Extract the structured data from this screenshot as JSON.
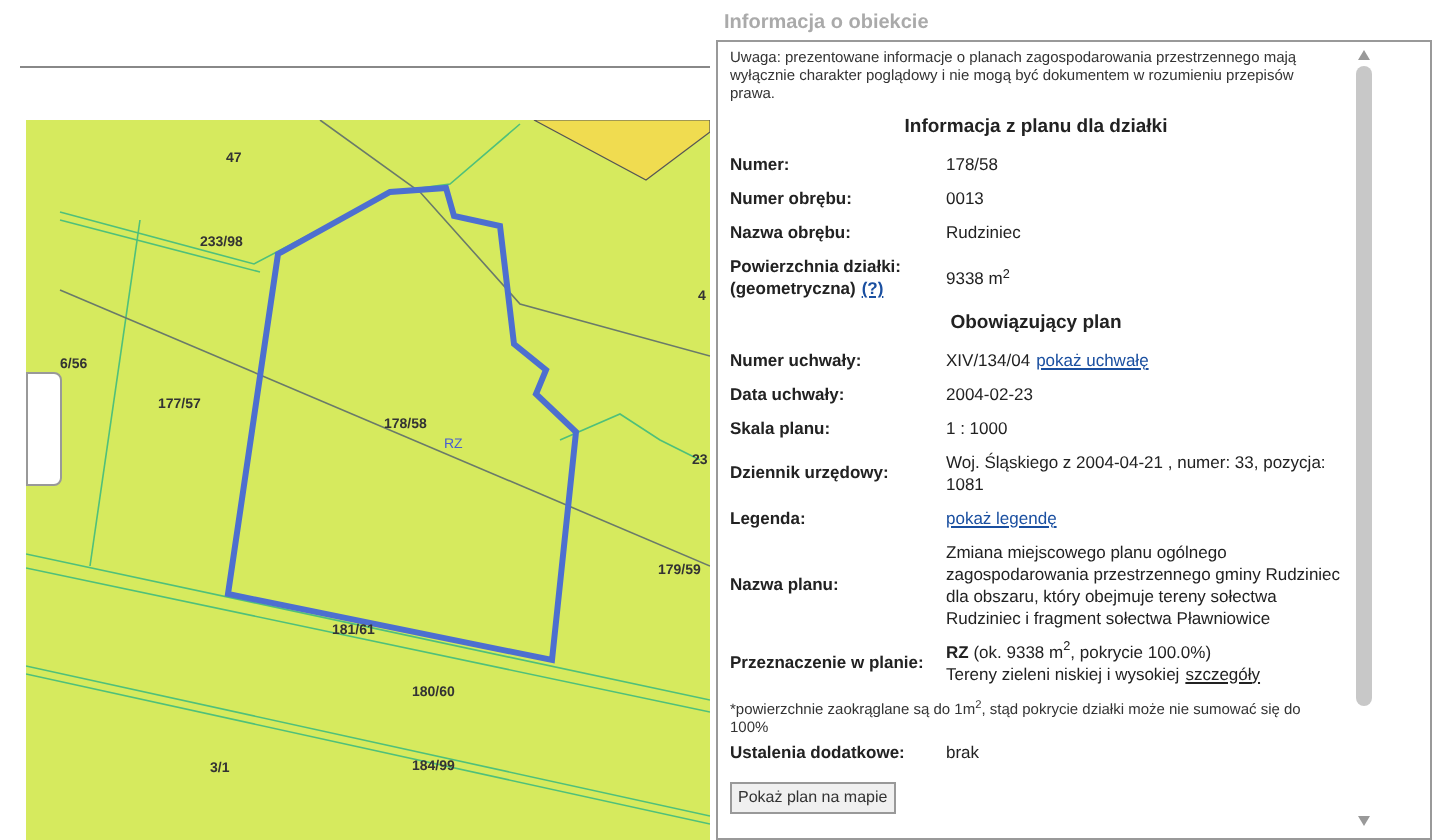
{
  "map": {
    "labels": [
      {
        "text": "47",
        "kind": "parcel"
      },
      {
        "text": "233/98",
        "kind": "parcel"
      },
      {
        "text": "6/56",
        "kind": "parcel"
      },
      {
        "text": "177/57",
        "kind": "parcel"
      },
      {
        "text": "178/58",
        "kind": "parcel"
      },
      {
        "text": "RZ",
        "kind": "zone"
      },
      {
        "text": "179/59",
        "kind": "parcel"
      },
      {
        "text": "181/61",
        "kind": "parcel"
      },
      {
        "text": "180/60",
        "kind": "parcel"
      },
      {
        "text": "3/1",
        "kind": "parcel"
      },
      {
        "text": "184/99",
        "kind": "parcel"
      },
      {
        "text": "4",
        "kind": "parcel"
      },
      {
        "text": "23",
        "kind": "parcel"
      }
    ]
  },
  "panel": {
    "title": "Informacja o obiekcie",
    "notice": "Uwaga: prezentowane informacje o planach zagospodarowania przestrzennego mają wyłącznie charakter poglądowy i nie mogą być dokumentem w rozumieniu przepisów prawa.",
    "heading": "Informacja z planu dla działki",
    "rows": [
      {
        "label": "Numer:",
        "value": "178/58"
      },
      {
        "label": "Numer obrębu:",
        "value": "0013"
      },
      {
        "label": "Nazwa obrębu:",
        "value": "Rudziniec"
      },
      {
        "label": "Powierzchnia działki:",
        "label2": "(geometryczna)",
        "label_link": "(?)",
        "value": "9338 m$^{2}$"
      }
    ],
    "plan_heading": "Obowiązujący plan",
    "plan_rows": [
      {
        "label": "Numer uchwały:",
        "value": "XIV/134/04",
        "link": "pokaż uchwałę"
      },
      {
        "label": "Data uchwały:",
        "value": "2004-02-23"
      },
      {
        "label": "Skala planu:",
        "value": "1 : 1000"
      },
      {
        "label": "Dziennik urzędowy:",
        "value": "Woj. Śląskiego z 2004-04-21 , numer: 33, pozycja: 1081"
      },
      {
        "label": "Legenda:",
        "link": "pokaż legendę"
      },
      {
        "label": "Nazwa planu:",
        "value": "Zmiana miejscowego planu ogólnego zagospodarowania przestrzennego gminy Rudziniec dla obszaru, który obejmuje tereny sołectwa Rudziniec i fragment sołectwa Pławniowice"
      },
      {
        "label": "Przeznaczenie w planie:",
        "value": "**RZ** (ok. 9338 m$^{2}$, pokrycie 100.0%)",
        "value2": "Tereny zieleni niskiej i wysokiej",
        "link": "szczegóły"
      }
    ],
    "footnote": "*powierzchnie zaokrąglane są do 1m$^{2}$, stąd pokrycie działki może nie sumować się do 100%",
    "extra_rows": [
      {
        "label": "Ustalenia dodatkowe:",
        "value": "brak"
      }
    ],
    "button": "Pokaż plan na mapie"
  }
}
